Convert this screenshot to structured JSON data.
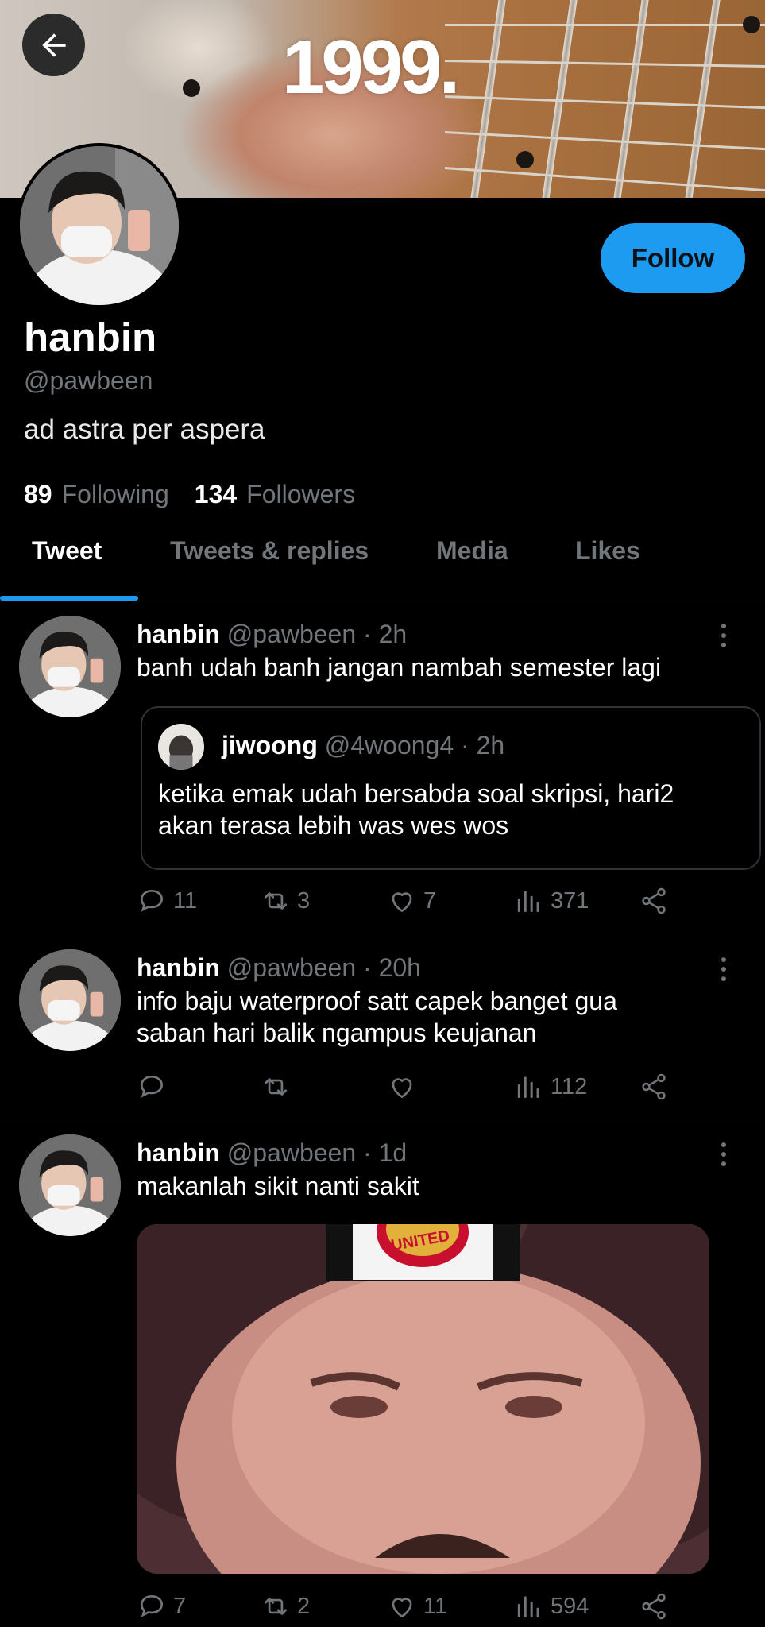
{
  "header": {
    "banner_text": "1999."
  },
  "profile": {
    "name": "hanbin",
    "handle": "@pawbeen",
    "bio": "ad astra per aspera",
    "following_count": "89",
    "following_label": "Following",
    "followers_count": "134",
    "followers_label": "Followers",
    "follow_label": "Follow"
  },
  "tabs": [
    {
      "label": "Tweet"
    },
    {
      "label": "Tweets & replies"
    },
    {
      "label": "Media"
    },
    {
      "label": "Likes"
    }
  ],
  "tweets": [
    {
      "name": "hanbin",
      "meta": "@pawbeen · 2h",
      "text": "banh udah banh jangan nambah semester lagi",
      "quote": {
        "name": "jiwoong",
        "meta": "@4woong4 · 2h",
        "text": "ketika emak udah bersabda soal skripsi, hari2 akan terasa lebih was wes wos"
      },
      "replies": "11",
      "retweets": "3",
      "likes": "7",
      "views": "371"
    },
    {
      "name": "hanbin",
      "meta": "@pawbeen · 20h",
      "text": "info baju waterproof satt capek banget gua saban hari balik ngampus keujanan",
      "replies": "",
      "retweets": "",
      "likes": "",
      "views": "112"
    },
    {
      "name": "hanbin",
      "meta": "@pawbeen · 1d",
      "text": "makanlah sikit nanti sakit",
      "media_caption": "UNITED",
      "replies": "7",
      "retweets": "2",
      "likes": "11",
      "views": "594"
    }
  ],
  "icons": {
    "back": "arrow-left-icon",
    "more": "more-vertical-icon",
    "reply": "comment-icon",
    "retweet": "retweet-icon",
    "like": "heart-icon",
    "views": "chart-bars-icon",
    "share": "share-icon"
  },
  "colors": {
    "accent": "#1d9bf0",
    "background": "#000000",
    "muted": "#71767b",
    "divider": "#2f3336"
  }
}
